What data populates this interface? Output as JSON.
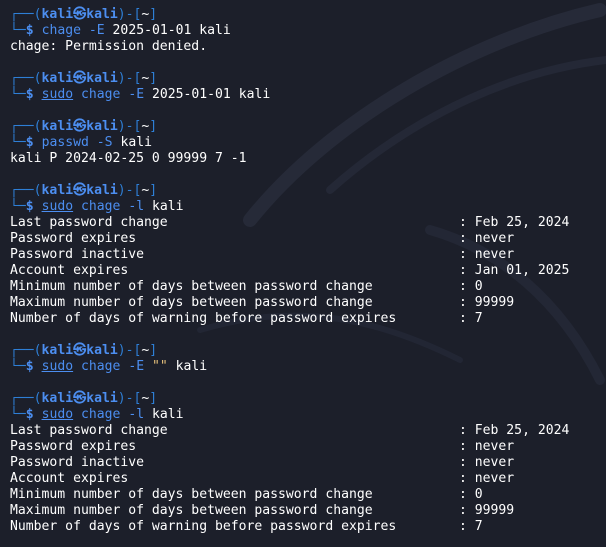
{
  "prompt": {
    "open": "┌──(",
    "user": "kali",
    "at": "㉿",
    "host": "kali",
    "mid": ")-[",
    "dir": "~",
    "close": "]",
    "lead": "└─",
    "symbol": "$"
  },
  "block1": {
    "cmd": "chage",
    "flag": "-E",
    "args": "2025-01-01 kali",
    "output": "chage: Permission denied."
  },
  "block2": {
    "sudo": "sudo",
    "cmd": "chage",
    "flag": "-E",
    "args": "2025-01-01 kali"
  },
  "block3": {
    "cmd": "passwd",
    "flag": "-S",
    "args": "kali",
    "output": "kali P 2024-02-25 0 99999 7 -1"
  },
  "block4": {
    "sudo": "sudo",
    "cmd": "chage",
    "flag": "-l",
    "args": "kali",
    "rows": [
      {
        "label": "Last password change",
        "value": ": Feb 25, 2024"
      },
      {
        "label": "Password expires",
        "value": ": never"
      },
      {
        "label": "Password inactive",
        "value": ": never"
      },
      {
        "label": "Account expires",
        "value": ": Jan 01, 2025"
      },
      {
        "label": "Minimum number of days between password change",
        "value": ": 0"
      },
      {
        "label": "Maximum number of days between password change",
        "value": ": 99999"
      },
      {
        "label": "Number of days of warning before password expires",
        "value": ": 7"
      }
    ]
  },
  "block5": {
    "sudo": "sudo",
    "cmd": "chage",
    "flag": "-E",
    "str": "\"\"",
    "args": "kali"
  },
  "block6": {
    "sudo": "sudo",
    "cmd": "chage",
    "flag": "-l",
    "args": "kali",
    "rows": [
      {
        "label": "Last password change",
        "value": ": Feb 25, 2024"
      },
      {
        "label": "Password expires",
        "value": ": never"
      },
      {
        "label": "Password inactive",
        "value": ": never"
      },
      {
        "label": "Account expires",
        "value": ": never"
      },
      {
        "label": "Minimum number of days between password change",
        "value": ": 0"
      },
      {
        "label": "Maximum number of days between password change",
        "value": ": 99999"
      },
      {
        "label": "Number of days of warning before password expires",
        "value": ": 7"
      }
    ]
  }
}
